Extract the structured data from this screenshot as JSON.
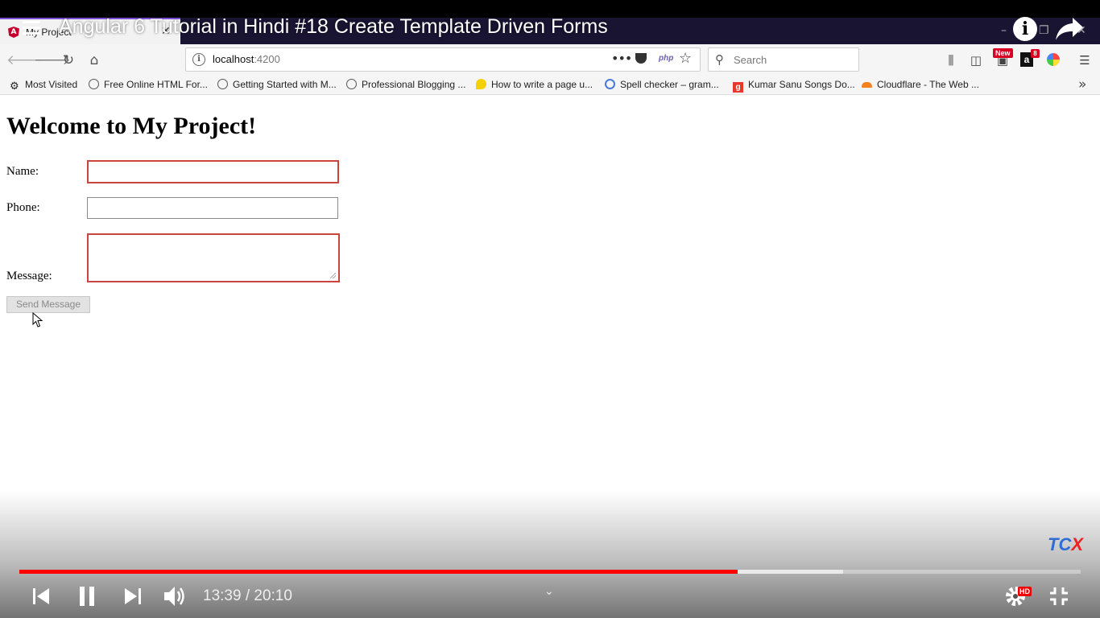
{
  "browser": {
    "tab_title": "My Project",
    "tab_icon": "A",
    "url_host": "localhost",
    "url_port": ":4200",
    "search_placeholder": "Search",
    "new_badge": "New",
    "amazon_icon": "a",
    "amazon_badge": "8",
    "php_label": "php",
    "bookmarks": [
      {
        "label": "Most Visited",
        "icon": "gear-icon"
      },
      {
        "label": "Free Online HTML For...",
        "icon": "globe-icon"
      },
      {
        "label": "Getting Started with M...",
        "icon": "globe-icon"
      },
      {
        "label": "Professional Blogging ...",
        "icon": "globe-icon"
      },
      {
        "label": "How to write a page u...",
        "icon": "bird-icon"
      },
      {
        "label": "Spell checker – gram...",
        "icon": "spell-icon"
      },
      {
        "label": "Kumar Sanu Songs Do...",
        "icon": "g-icon"
      },
      {
        "label": "Cloudflare - The Web ...",
        "icon": "cloud-icon"
      }
    ]
  },
  "video": {
    "title": "Angular 6 Tutorial in Hindi #18 Create Template Driven Forms",
    "time": "13:39 / 20:10",
    "progress_played": 0.677,
    "progress_buffered": 0.776,
    "watermark_left": "TC",
    "watermark_right": "X",
    "hd_badge": "HD",
    "accent_color": "#ff0000"
  },
  "page": {
    "heading": "Welcome to My Project!",
    "name_label": "Name:",
    "phone_label": "Phone:",
    "message_label": "Message:",
    "name_value": "",
    "phone_value": "",
    "message_value": "",
    "send_button": "Send Message",
    "invalid_color": "#c9453d"
  }
}
